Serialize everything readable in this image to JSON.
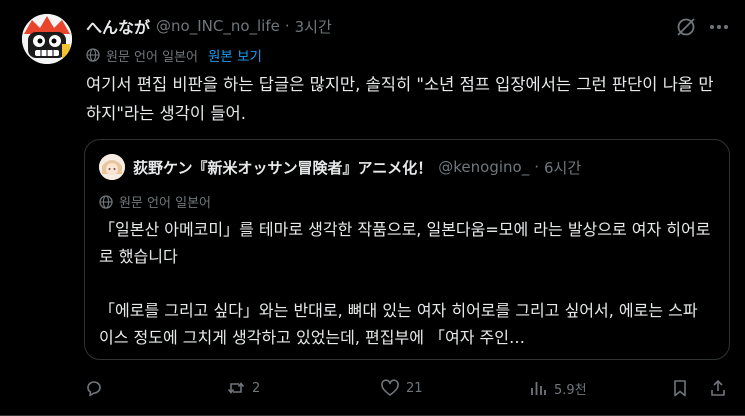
{
  "author": {
    "display_name": "へんなが",
    "handle": "@no_INC_no_life",
    "time": "3시간"
  },
  "translate": {
    "source_label": "원문 언어 일본어",
    "link_label": "원본 보기"
  },
  "post_text": "여기서 편집 비판을 하는 답글은 많지만, 솔직히 \"소년 점프 입장에서는 그런 판단이 나올 만하지\"라는 생각이 들어.",
  "quoted": {
    "display_name": "荻野ケン『新米オッサン冒険者』アニメ化！",
    "handle": "@kenogino_",
    "time": "6시간",
    "translate_label": "원문 언어 일본어",
    "paragraph1": "「일본산 아메코미」를 테마로 생각한 작품으로, 일본다움=모에 라는 발상으로 여자 히어로로 했습니다",
    "paragraph2": "「에로를 그리고 싶다」와는 반대로, 뼈대 있는 여자 히어로를 그리고 싶어서, 에로는 스파이스 정도에 그치게 생각하고 있었는데, 편집부에 「여자 주인…"
  },
  "actions": {
    "reply_count": "",
    "repost_count": "2",
    "like_count": "21",
    "view_count": "5.9천"
  },
  "colors": {
    "background": "#000000",
    "text": "#e7e9ea",
    "muted": "#71767b",
    "link": "#1d9bf0",
    "border": "#2f3336"
  },
  "icons": [
    "grok-icon",
    "more-icon",
    "translate-icon",
    "reply-icon",
    "repost-icon",
    "like-icon",
    "views-icon",
    "bookmark-icon",
    "share-icon"
  ]
}
